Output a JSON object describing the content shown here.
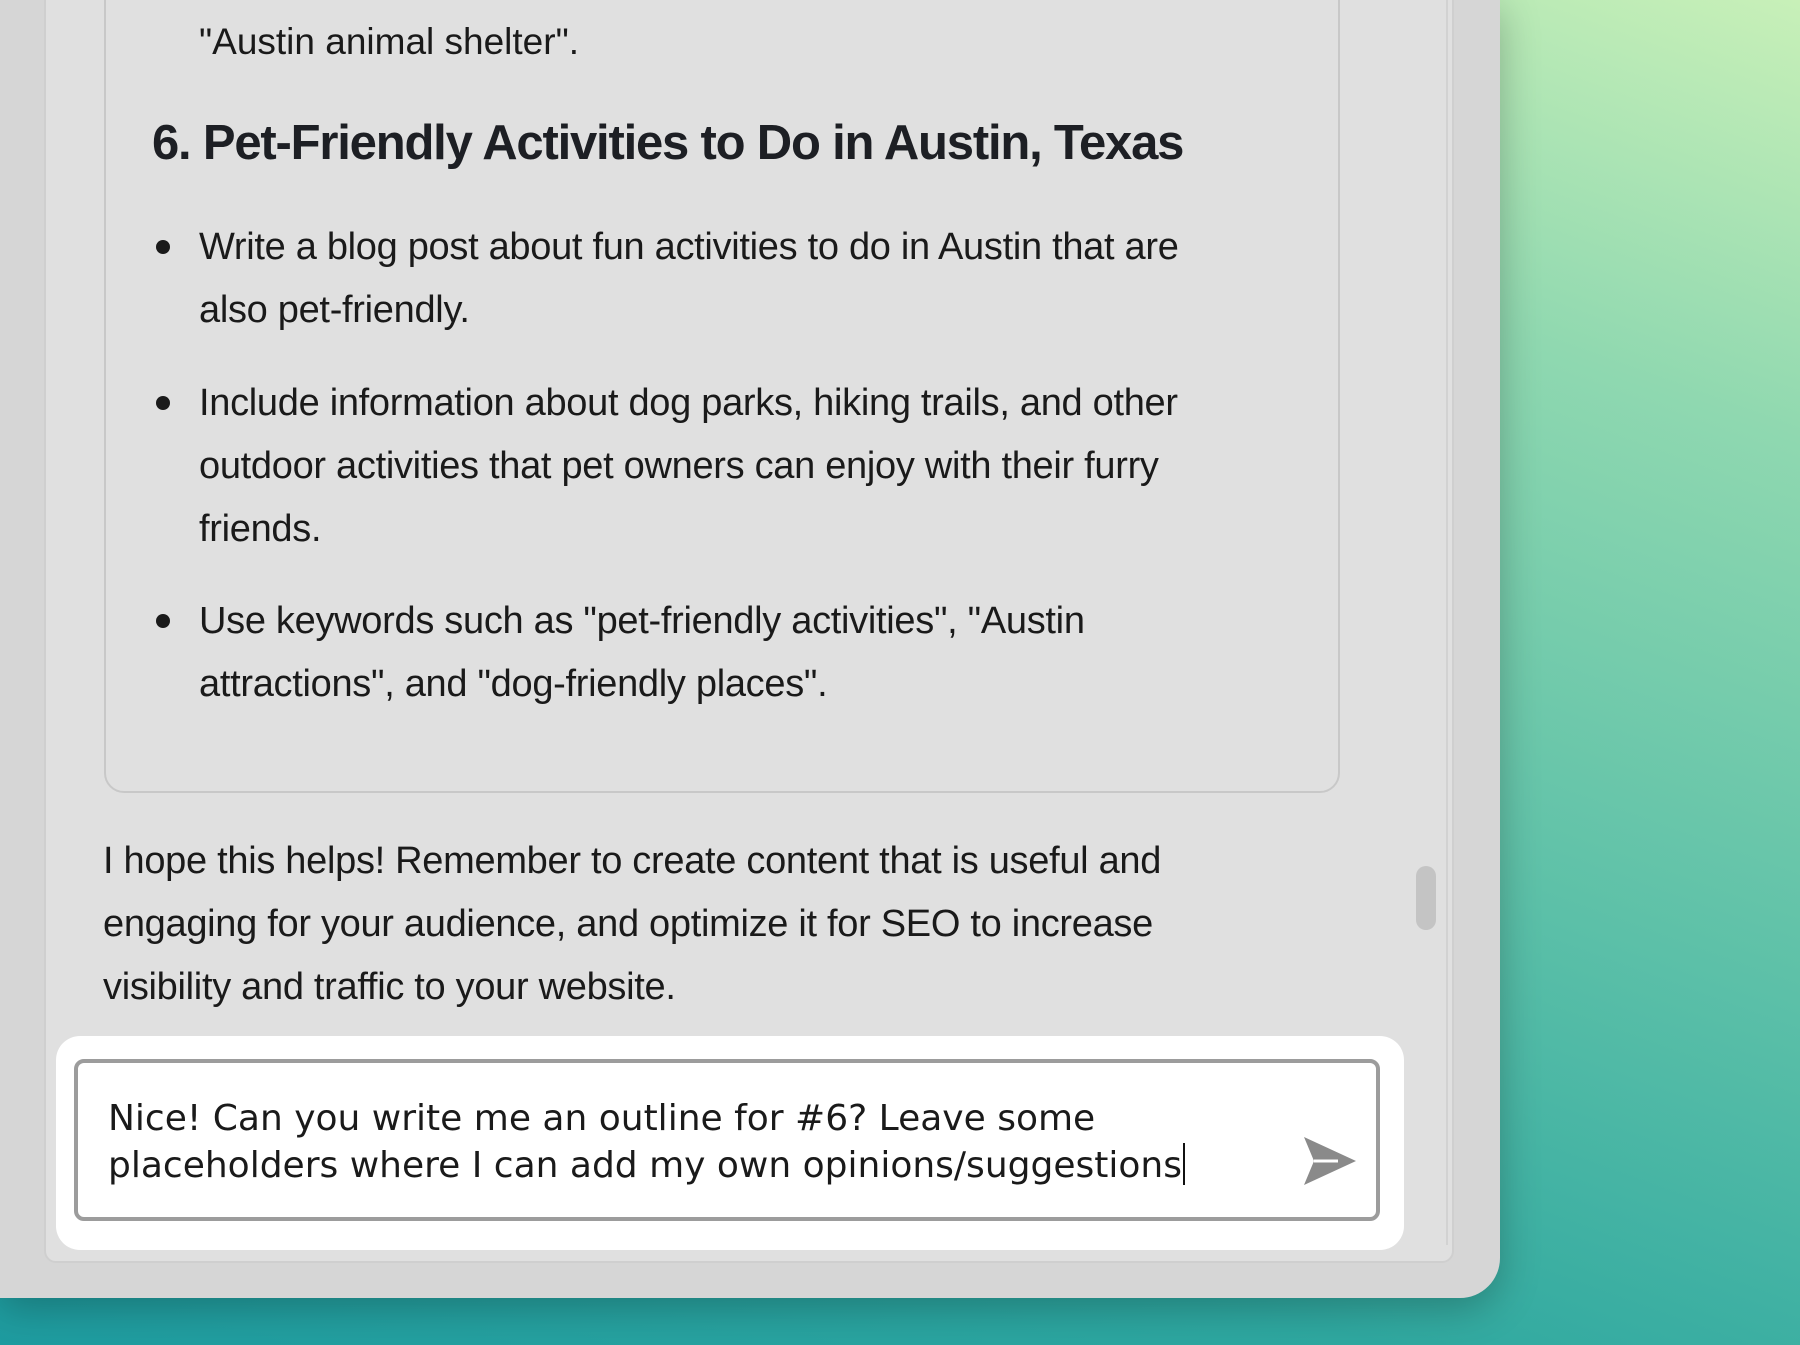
{
  "answer": {
    "continuation_line": "\"Austin animal shelter\".",
    "section_heading": "6. Pet-Friendly Activities to Do in Austin, Texas",
    "bullets": [
      {
        "line1": "Write a blog post about fun activities to do in Austin that are",
        "line2": "also pet-friendly."
      },
      {
        "line1": "Include information about dog parks, hiking trails, and other",
        "line2": "outdoor activities that pet owners can enjoy with their furry",
        "line3": "friends."
      },
      {
        "line1": "Use keywords such as \"pet-friendly activities\", \"Austin",
        "line2": "attractions\", and \"dog-friendly places\"."
      }
    ]
  },
  "closing": {
    "line1": "I hope this helps! Remember to create content that is useful and",
    "line2": "engaging for your audience, and optimize it for SEO to increase",
    "line3": "visibility and traffic to your website."
  },
  "composer": {
    "line1": "Nice! Can you write me an outline for #6? Leave some",
    "line2": "placeholders where I can add my own opinions/suggestions",
    "send_icon": "paper-plane-send-icon"
  },
  "colors": {
    "window_background": "#d6d6d6",
    "panel_background": "#e0e0e0",
    "text": "#1a1a1a",
    "send_icon": "#8a8a8a",
    "composer_border": "#9c9c9c"
  }
}
